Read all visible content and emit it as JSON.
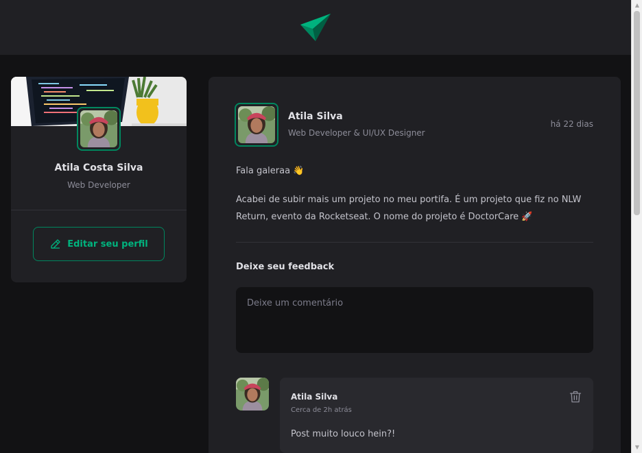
{
  "colors": {
    "background": "#121214",
    "surface": "#202024",
    "accent": "#00875f",
    "accent_light": "#00b37e"
  },
  "header": {
    "logo_icon": "paper-plane-logo-icon"
  },
  "sidebar": {
    "name": "Atila Costa Silva",
    "role": "Web Developer",
    "edit_label": "Editar seu perfil",
    "edit_icon": "pencil-icon"
  },
  "post": {
    "author": {
      "name": "Atila Silva",
      "role": "Web Developer & UI/UX Designer"
    },
    "time": "há 22 dias",
    "content": [
      "Fala galeraa 👋",
      "Acabei de subir mais um projeto no meu portifa. É um projeto que fiz no NLW Return, evento da Rocketseat. O nome do projeto é DoctorCare 🚀"
    ],
    "feedback_title": "Deixe seu feedback",
    "comment_placeholder": "Deixe um comentário"
  },
  "comments": [
    {
      "author": "Atila Silva",
      "time": "Cerca de 2h atrás",
      "text": "Post muito louco hein?!",
      "delete_icon": "trash-icon"
    }
  ]
}
